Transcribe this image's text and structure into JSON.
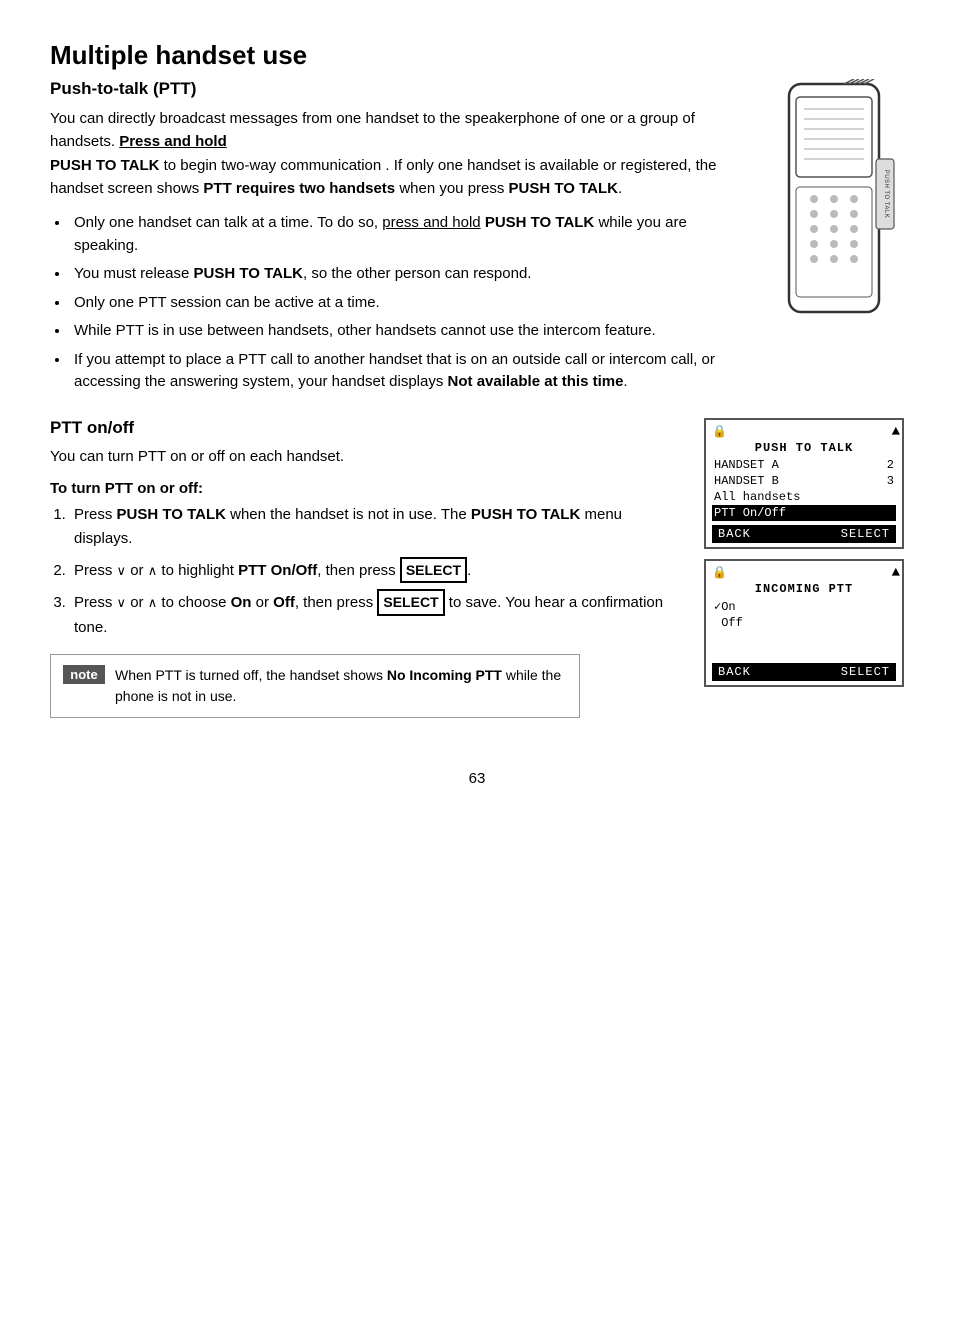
{
  "page": {
    "title": "Multiple handset use",
    "section1": {
      "title": "Push-to-talk (PTT)",
      "intro": "You can directly broadcast messages from one handset to the speakerphone of one or a group of handsets.",
      "intro_underline": "Press and hold",
      "intro_bold1": "PUSH TO TALK",
      "intro_rest": " to begin two-way communication . If only one handset is available or registered, the handset screen shows ",
      "intro_bold2": "PTT requires two handsets",
      "intro_end": " when you press ",
      "intro_bold3": "PUSH TO TALK",
      "intro_period": ".",
      "bullets": [
        {
          "text_before": "Only one handset can talk at a time. To do so, ",
          "text_underline": "press and hold",
          "text_bold": " PUSH TO TALK",
          "text_after": " while you are speaking."
        },
        {
          "text_before": "You must release ",
          "text_bold": "PUSH TO TALK",
          "text_after": ", so the other person can respond."
        },
        {
          "text": "Only one PTT session can be active at a time."
        },
        {
          "text": "While PTT is in use between handsets, other handsets cannot use the intercom feature."
        },
        {
          "text_before": "If you attempt to place a PTT call to another handset that is on an outside call or intercom call, or accessing the answering system, your handset displays ",
          "text_bold": "Not available at this time",
          "text_period": "."
        }
      ]
    },
    "section2": {
      "title": "PTT on/off",
      "intro": "You can turn PTT on or off on each handset.",
      "sub_title": "To turn PTT on or off:",
      "steps": [
        {
          "text_before": "Press ",
          "text_bold": "PUSH TO TALK",
          "text_after": " when the handset is not in use. The ",
          "text_bold2": "PUSH TO TALK",
          "text_end": " menu displays."
        },
        {
          "text_before": "Press ",
          "arrow_down": "∨",
          "text_or": " or ",
          "arrow_up": "∧",
          "text_after": " to highlight ",
          "text_bold": "PTT On/Off",
          "text_end": ", then press ",
          "select_label": "SELECT",
          "text_period": "."
        },
        {
          "text_before": "Press ",
          "arrow_down": "∨",
          "text_or": " or ",
          "arrow_up": "∧",
          "text_after": " to choose ",
          "text_bold_on": "On",
          "text_or2": " or ",
          "text_bold_off": "Off",
          "text_end": ", then press ",
          "select_label": "SELECT",
          "text_save": " to save. You hear a confirmation tone."
        }
      ],
      "note": {
        "label": "note",
        "text_before": "When PTT is turned off, the handset shows ",
        "text_bold": "No Incoming PTT",
        "text_after": " while the phone is not in use."
      }
    },
    "screen1": {
      "lock_icon": "🔒",
      "arrow": "▲",
      "title": "PUSH TO TALK",
      "rows": [
        {
          "label": "HANDSET A",
          "value": "2"
        },
        {
          "label": "HANDSET B",
          "value": "3"
        },
        {
          "label": "All handsets",
          "value": ""
        },
        {
          "label": "PTT On/Off",
          "value": "",
          "highlighted": true
        }
      ],
      "back": "BACK",
      "select": "SELECT"
    },
    "screen2": {
      "lock_icon": "🔒",
      "arrow": "▲",
      "title": "INCOMING PTT",
      "rows": [
        {
          "label": "✓On",
          "value": "",
          "highlighted": false
        },
        {
          "label": " Off",
          "value": "",
          "highlighted": false
        }
      ],
      "back": "BACK",
      "select": "SELECT"
    },
    "page_number": "63"
  }
}
